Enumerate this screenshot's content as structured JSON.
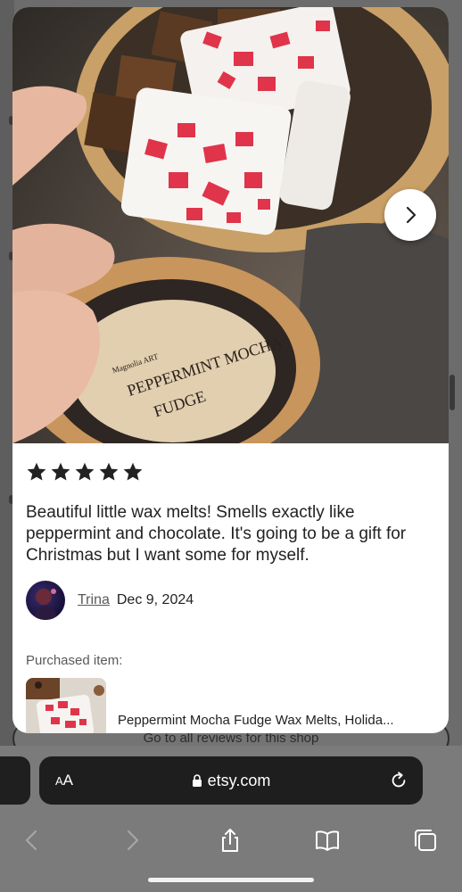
{
  "review": {
    "rating": 5,
    "max_rating": 5,
    "text": "Beautiful little wax melts! Smells exactly like peppermint and chocolate. It's going to be a gift for Christmas but I want some for myself.",
    "reviewer_name": "Trina",
    "date": "Dec 9, 2024",
    "photo_label": {
      "line1": "PEPPERMINT MOCHA",
      "line2": "FUDGE"
    },
    "brand_mark": "Magnolia ART"
  },
  "purchased": {
    "label": "Purchased item:",
    "title": "Peppermint Mocha Fudge Wax Melts, Holida..."
  },
  "background_page": {
    "reviews_button": "Go to all reviews for this shop"
  },
  "browser": {
    "aa_label_small": "A",
    "aa_label_large": "A",
    "url": "etsy.com"
  },
  "icons": {
    "next": "chevron-right-icon",
    "star": "star-icon",
    "lock": "lock-icon",
    "reload": "reload-icon",
    "back": "chevron-left-icon",
    "forward": "chevron-right-icon",
    "share": "share-icon",
    "bookmarks": "book-icon",
    "tabs": "tabs-icon"
  },
  "colors": {
    "star": "#222222",
    "candy_red": "#e0344a",
    "photo_dark": "#3c342e"
  }
}
